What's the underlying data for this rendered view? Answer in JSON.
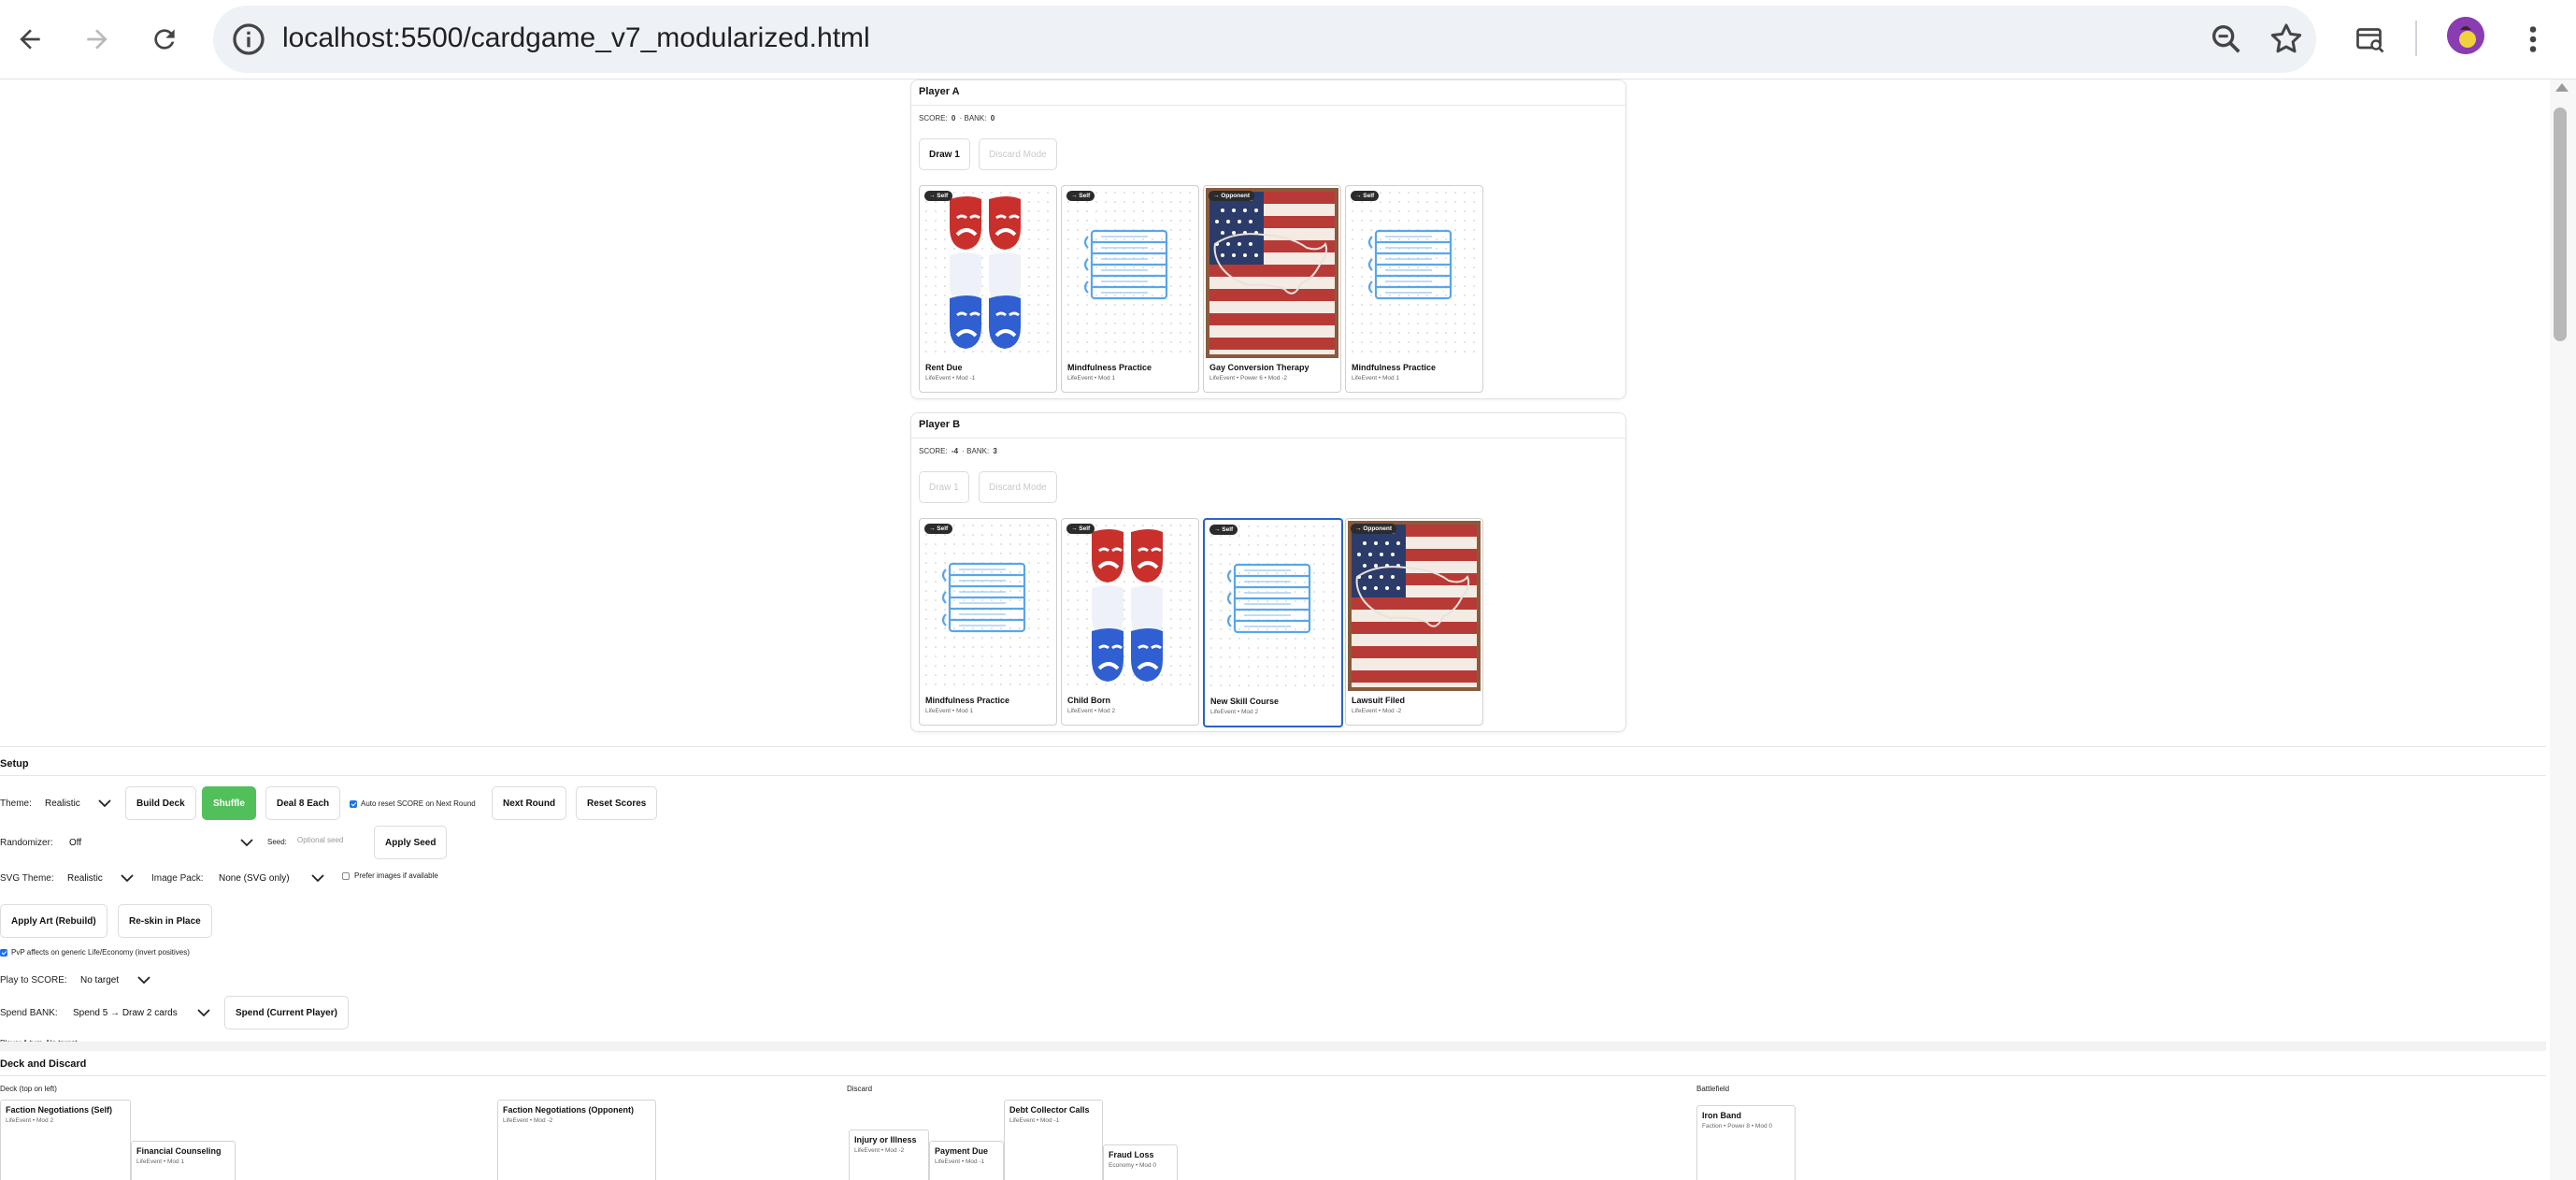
{
  "browser": {
    "url": "localhost:5500/cardgame_v7_modularized.html"
  },
  "players": [
    {
      "title": "Player A",
      "score_label": "SCORE:",
      "score": "0",
      "bank_label": "· BANK:",
      "bank": "0",
      "draw_label": "Draw 1",
      "draw_enabled": true,
      "discard_label": "Discard Mode",
      "cards": [
        {
          "badge": "→ Self",
          "name": "Rent Due",
          "meta": "LifeEvent • Mod -1",
          "art": "masks-icon"
        },
        {
          "badge": "→ Self",
          "name": "Mindfulness Practice",
          "meta": "LifeEvent • Mod 1",
          "art": "books-icon"
        },
        {
          "badge": "→ Opponent",
          "name": "Gay Conversion Therapy",
          "meta": "LifeEvent • Power 6 • Mod -2",
          "art": "flag-icon"
        },
        {
          "badge": "→ Self",
          "name": "Mindfulness Practice",
          "meta": "LifeEvent • Mod 1",
          "art": "books-icon"
        }
      ]
    },
    {
      "title": "Player B",
      "score_label": "SCORE:",
      "score": "-4",
      "bank_label": "· BANK:",
      "bank": "3",
      "draw_label": "Draw 1",
      "draw_enabled": false,
      "discard_label": "Discard Mode",
      "cards": [
        {
          "badge": "→ Self",
          "name": "Mindfulness Practice",
          "meta": "LifeEvent • Mod 1",
          "art": "books-icon"
        },
        {
          "badge": "→ Self",
          "name": "Child Born",
          "meta": "LifeEvent • Mod 2",
          "art": "masks-icon"
        },
        {
          "badge": "→ Self",
          "name": "New Skill Course",
          "meta": "LifeEvent • Mod 2",
          "art": "books-icon",
          "selected": true
        },
        {
          "badge": "→ Opponent",
          "name": "Lawsuit Filed",
          "meta": "LifeEvent • Mod -2",
          "art": "flag-icon"
        }
      ]
    }
  ],
  "setup": {
    "title": "Setup",
    "theme_label": "Theme:",
    "theme_value": "Realistic",
    "build_deck": "Build Deck",
    "shuffle": "Shuffle",
    "deal": "Deal 8 Each",
    "auto_reset_label": "Auto reset SCORE on Next Round",
    "auto_reset_checked": true,
    "next_round": "Next Round",
    "reset_scores": "Reset Scores",
    "randomizer_label": "Randomizer:",
    "randomizer_value": "Off",
    "seed_label": "Seed:",
    "seed_placeholder": "Optional seed",
    "apply_seed": "Apply Seed",
    "svg_theme_label": "SVG Theme:",
    "svg_theme_value": "Realistic",
    "image_pack_label": "Image Pack:",
    "image_pack_value": "None (SVG only)",
    "prefer_images_label": "Prefer images if available",
    "prefer_images_checked": false,
    "apply_art": "Apply Art (Rebuild)",
    "reskin": "Re-skin in Place",
    "pvp_label": "PvP affects on generic Life/Economy (invert positives)",
    "pvp_checked": true,
    "play_to_score_label": "Play to SCORE:",
    "play_to_score_value": "No target",
    "spend_bank_label": "Spend BANK:",
    "spend_bank_value": "Spend 5 → Draw 2 cards",
    "spend_current": "Spend (Current Player)",
    "status": "Player A turn. No target."
  },
  "deck_discard": {
    "title": "Deck and Discard",
    "deck_label": "Deck (top on left)",
    "discard_label": "Discard",
    "battlefield_label": "Battlefield",
    "deck_cards": [
      {
        "name": "Faction Negotiations (Self)",
        "meta": "LifeEvent • Mod 2"
      },
      {
        "name": "Financial Counseling",
        "meta": "LifeEvent • Mod 1"
      },
      {
        "name": "Faction Negotiations (Opponent)",
        "meta": "LifeEvent • Mod -2"
      }
    ],
    "discard_cards": [
      {
        "name": "Injury or Illness",
        "meta": "LifeEvent • Mod -2"
      },
      {
        "name": "Payment Due",
        "meta": "LifeEvent • Mod -1"
      },
      {
        "name": "Debt Collector Calls",
        "meta": "LifeEvent • Mod -1"
      },
      {
        "name": "Fraud Loss",
        "meta": "Economy • Mod 0"
      }
    ],
    "battlefield_cards": [
      {
        "name": "Iron Band",
        "meta": "Faction • Power 8 • Mod 0"
      }
    ]
  }
}
